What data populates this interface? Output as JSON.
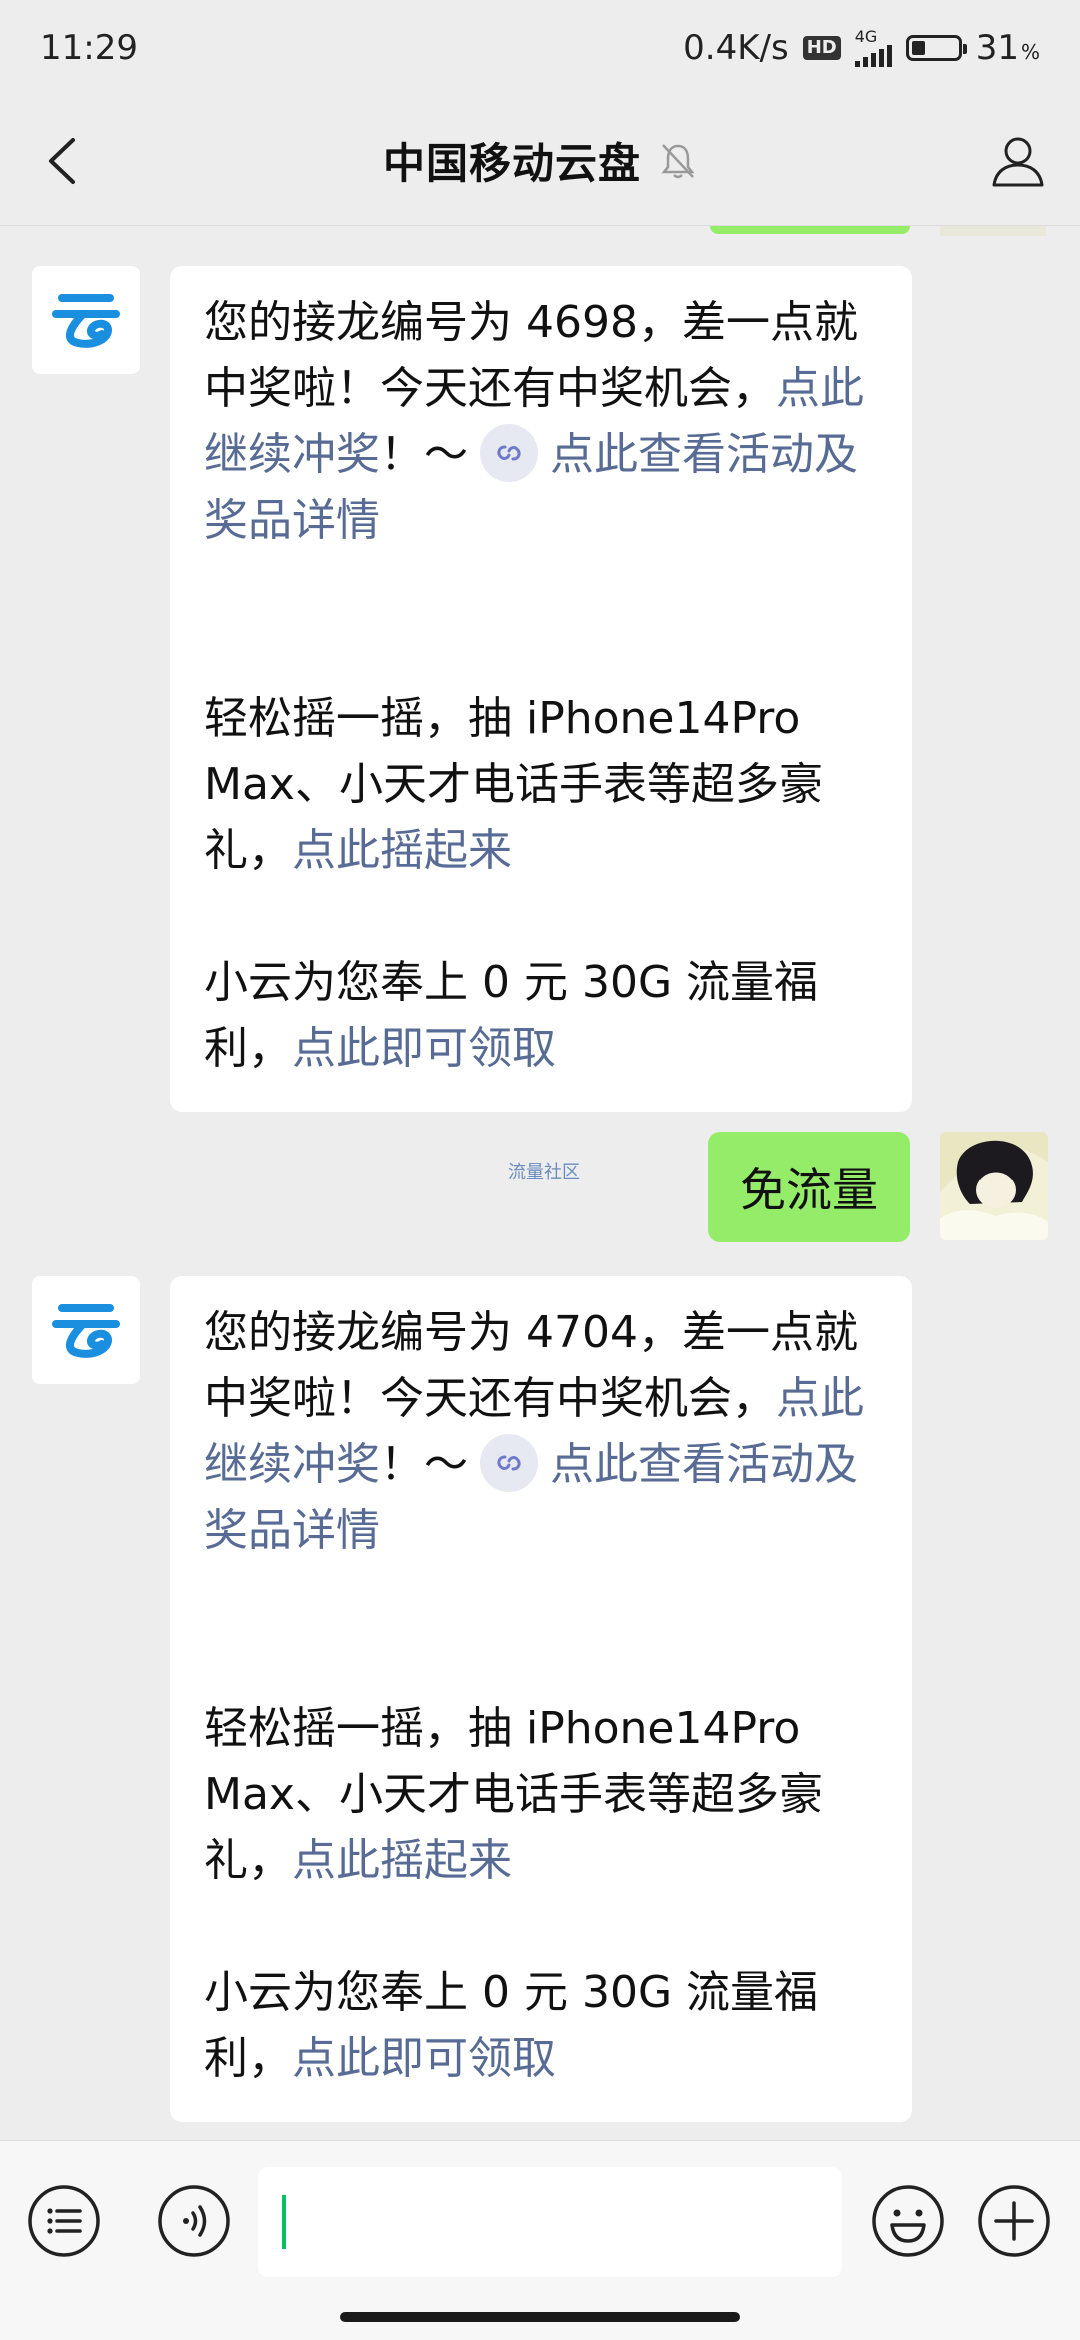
{
  "status_bar": {
    "time": "11:29",
    "speed": "0.4K/s",
    "hd": "HD",
    "network": "4G",
    "battery_level": 31,
    "battery_percent": "31",
    "battery_unit": "%"
  },
  "nav": {
    "title": "中国移动云盘",
    "icons": {
      "back": "chevron-left-icon",
      "mute": "bell-muted-icon",
      "profile": "person-icon"
    }
  },
  "chat": {
    "messages": [
      {
        "line1": "您的接龙编号为 4698，差一点就中奖啦！今天还有中奖机会，",
        "link1": "点此继续冲奖",
        "mid": "！～",
        "link2": "点此查看活动及奖品详情",
        "shake_text": "轻松摇一摇，抽 iPhone14Pro Max、小天才电话手表等超多豪礼，",
        "shake_link": "点此摇起来",
        "flow_text": "小云为您奉上 0 元 30G 流量福利，",
        "flow_link": "点此即可领取"
      },
      {
        "line1": "您的接龙编号为 4704，差一点就中奖啦！今天还有中奖机会，",
        "link1": "点此继续冲奖",
        "mid": "！～",
        "link2": "点此查看活动及奖品详情",
        "shake_text": "轻松摇一摇，抽 iPhone14Pro Max、小天才电话手表等超多豪礼，",
        "shake_link": "点此摇起来",
        "flow_text": "小云为您奉上 0 元 30G 流量福利，",
        "flow_link": "点此即可领取"
      }
    ],
    "system_label": "流量社区",
    "user_message": "免流量"
  },
  "input_bar": {
    "placeholder": "",
    "icons": [
      "menu-list-icon",
      "voice-icon",
      "emoji-icon",
      "plus-icon"
    ]
  },
  "colors": {
    "link": "#576b95",
    "green_bubble": "#95ec69",
    "background": "#ededed",
    "brand_blue": "#1a8fe0"
  }
}
